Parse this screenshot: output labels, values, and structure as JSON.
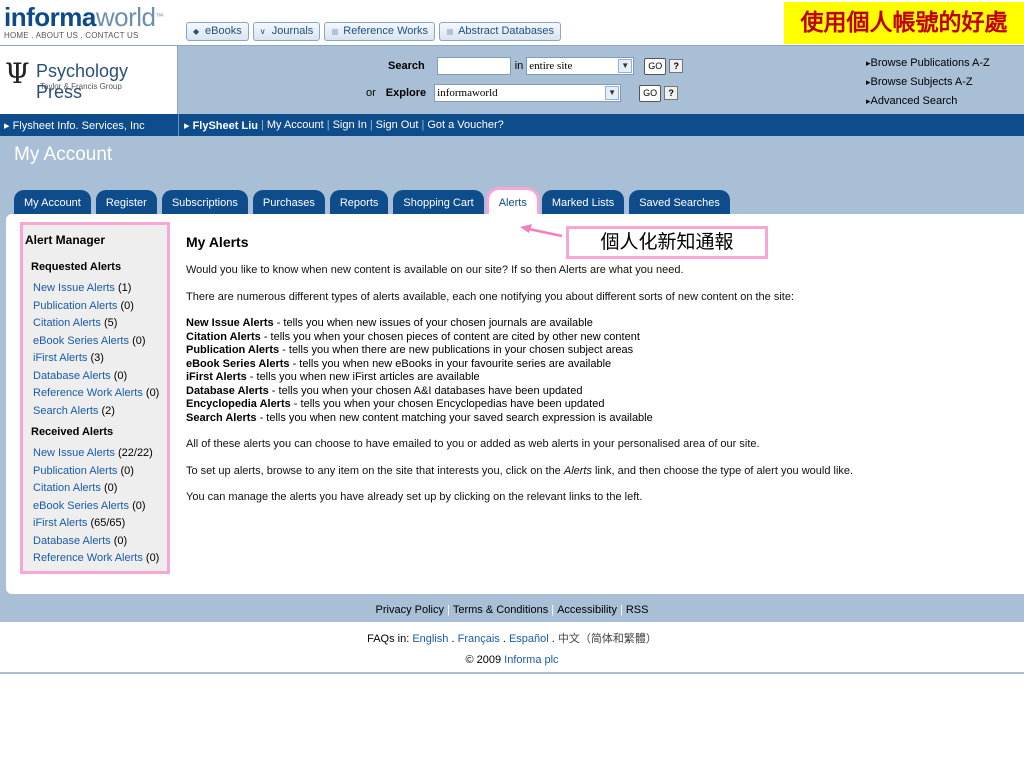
{
  "header": {
    "brand_main": "informa",
    "brand_sub": "world",
    "brand_tm": "™",
    "links": "HOME . ABOUT US . CONTACT US",
    "tabs": [
      {
        "label": "eBooks",
        "icon": "diamond-icon"
      },
      {
        "label": "Journals",
        "icon": "chevron-icon"
      },
      {
        "label": "Reference Works",
        "icon": "book-icon"
      },
      {
        "label": "Abstract Databases",
        "icon": "database-icon"
      }
    ],
    "banner": "使用個人帳號的好處"
  },
  "publisher": {
    "symbol": "Ψ",
    "name": "Psychology Press",
    "sub": "Taylor & Francis Group"
  },
  "search": {
    "search_label": "Search",
    "in_label": "in",
    "scope_value": "entire site",
    "go_label": "GO",
    "help_label": "?",
    "or_label": "or",
    "explore_label": "Explore",
    "explore_value": "informaworld"
  },
  "browse": {
    "publications": "Browse Publications A-Z",
    "subjects": "Browse Subjects A-Z",
    "advanced": "Advanced Search"
  },
  "nav": {
    "org": "Flysheet Info. Services, Inc",
    "user": "FlySheet Liu",
    "links": [
      "My Account",
      "Sign In",
      "Sign Out",
      "Got a Voucher?"
    ]
  },
  "page": {
    "title": "My Account",
    "tabs": [
      "My Account",
      "Register",
      "Subscriptions",
      "Purchases",
      "Reports",
      "Shopping Cart",
      "Alerts",
      "Marked Lists",
      "Saved Searches"
    ],
    "active_tab": "Alerts"
  },
  "sidebar": {
    "title": "Alert Manager",
    "requested_heading": "Requested Alerts",
    "requested": [
      {
        "label": "New Issue Alerts",
        "count": "(1)"
      },
      {
        "label": "Publication Alerts",
        "count": "(0)"
      },
      {
        "label": "Citation Alerts",
        "count": "(5)"
      },
      {
        "label": "eBook Series Alerts",
        "count": "(0)"
      },
      {
        "label": "iFirst Alerts",
        "count": "(3)"
      },
      {
        "label": "Database Alerts",
        "count": "(0)"
      },
      {
        "label": "Reference Work Alerts",
        "count": "(0)"
      },
      {
        "label": "Search Alerts",
        "count": "(2)"
      }
    ],
    "received_heading": "Received Alerts",
    "received": [
      {
        "label": "New Issue Alerts",
        "count": "(22/22)"
      },
      {
        "label": "Publication Alerts",
        "count": "(0)"
      },
      {
        "label": "Citation Alerts",
        "count": "(0)"
      },
      {
        "label": "eBook Series Alerts",
        "count": "(0)"
      },
      {
        "label": "iFirst Alerts",
        "count": "(65/65)"
      },
      {
        "label": "Database Alerts",
        "count": "(0)"
      },
      {
        "label": "Reference Work Alerts",
        "count": "(0)"
      }
    ]
  },
  "content": {
    "heading": "My Alerts",
    "intro": "Would you like to know when new content is available on our site? If so then Alerts are what you need.",
    "types_intro": "There are numerous different types of alerts available, each one notifying you about different sorts of new content on the site:",
    "alert_types": [
      {
        "name": "New Issue Alerts",
        "desc": " - tells you when new issues of your chosen journals are available"
      },
      {
        "name": "Citation Alerts",
        "desc": " - tells you when your chosen pieces of content are cited by other new content"
      },
      {
        "name": "Publication Alerts",
        "desc": " - tells you when there are new publications in your chosen subject areas"
      },
      {
        "name": "eBook Series Alerts",
        "desc": " - tells you when new eBooks in your favourite series are available"
      },
      {
        "name": "iFirst Alerts",
        "desc": " - tells you when new iFirst articles are available"
      },
      {
        "name": "Database Alerts",
        "desc": " - tells you when your chosen A&I databases have been updated"
      },
      {
        "name": "Encyclopedia Alerts",
        "desc": " - tells you when your chosen Encyclopedias have been updated"
      },
      {
        "name": "Search Alerts",
        "desc": " - tells you when new content matching your saved search expression is available"
      }
    ],
    "emailed": "All of these alerts you can choose to have emailed to you or added as web alerts in your personalised area of our site.",
    "setup_pre": "To set up alerts, browse to any item on the site that interests you, click on the ",
    "setup_link": "Alerts",
    "setup_post": " link, and then choose the type of alert you would like.",
    "manage": "You can manage the alerts you have already set up by clicking on the relevant links to the left."
  },
  "callout": "個人化新知通報",
  "footer": {
    "links": [
      "Privacy Policy",
      "Terms & Conditions",
      "Accessibility",
      "RSS"
    ],
    "faq_label": "FAQs in:",
    "languages": [
      "English",
      "Français",
      "Español",
      "中文（简体和繁體）"
    ],
    "copyright": "© 2009",
    "company": "Informa plc"
  },
  "colors": {
    "brand_blue": "#0e4c8c",
    "band": "#a8bfd6",
    "highlight_pink": "#f7a6d6",
    "banner_yellow": "#ffff00",
    "banner_red": "#c00000"
  }
}
